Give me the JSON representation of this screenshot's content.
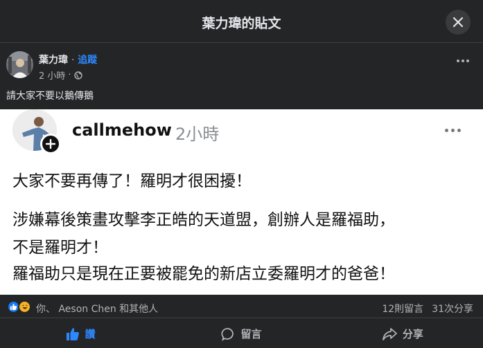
{
  "dialog": {
    "title": "葉力瑋的貼文"
  },
  "post": {
    "author": "葉力瑋",
    "separator": "·",
    "follow_label": "追蹤",
    "time": "2 小時",
    "meta_separator": "·",
    "text": "請大家不要以鵝傳鵝"
  },
  "shared_image": {
    "username": "callmehow",
    "time": "2小時",
    "lines": [
      "大家不要再傳了！羅明才很困擾！",
      "涉嫌幕後策畫攻擊李正皓的天道盟，創辦人是羅福助，",
      "不是羅明才！",
      "羅福助只是現在正要被罷免的新店立委羅明才的爸爸！"
    ]
  },
  "reactions": {
    "summary": "你、 Aeson Chen 和其他人",
    "comments": "12則留言",
    "shares": "31次分享"
  },
  "actions": {
    "like": "讚",
    "comment": "留言",
    "share": "分享"
  },
  "colors": {
    "accent": "#2d88ff",
    "background": "#242526",
    "card": "#ffffff"
  }
}
